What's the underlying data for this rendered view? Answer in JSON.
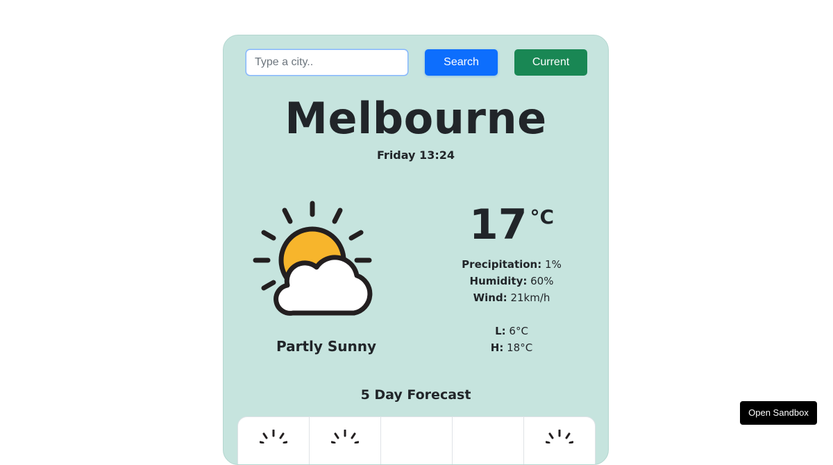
{
  "search": {
    "placeholder": "Type a city..",
    "value": "",
    "search_label": "Search",
    "current_label": "Current"
  },
  "weather": {
    "city": "Melbourne",
    "datetime": "Friday 13:24",
    "icon": "partly-sunny-icon",
    "description": "Partly Sunny",
    "temperature": "17",
    "unit": "°C",
    "precipitation_label": "Precipitation:",
    "precipitation": "1%",
    "humidity_label": "Humidity:",
    "humidity": "60%",
    "wind_label": "Wind:",
    "wind": "21km/h",
    "low_label": "L:",
    "low": "6°C",
    "high_label": "H:",
    "high": "18°C"
  },
  "forecast": {
    "title": "5 Day Forecast",
    "days": [
      {
        "icon": "sun-icon"
      },
      {
        "icon": "sun-icon"
      },
      {
        "icon": "unknown"
      },
      {
        "icon": "unknown"
      },
      {
        "icon": "sun-icon"
      }
    ]
  },
  "sandbox": {
    "label": "Open Sandbox"
  },
  "colors": {
    "card_background": "#c6e4de",
    "search_button": "#0d6efd",
    "current_button": "#198754",
    "sun": "#f7b52c"
  }
}
